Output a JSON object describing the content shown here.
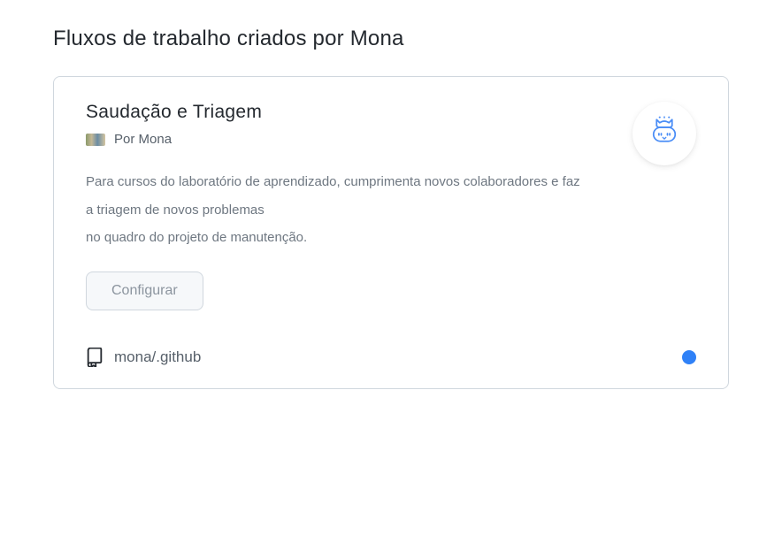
{
  "page": {
    "title": "Fluxos de trabalho criados por Mona"
  },
  "card": {
    "title": "Saudação e Triagem",
    "byline_prefix": "Por ",
    "author": "Mona",
    "description_line1": "Para cursos do laboratório de aprendizado, cumprimenta novos colaboradores e faz a triagem de novos problemas",
    "description_line2": "no quadro do projeto de manutenção.",
    "configure_label": "Configurar",
    "repo_path": "mona/.github",
    "status_color": "#2f81f7"
  },
  "icons": {
    "repo": "repo-icon",
    "mona": "mona-icon"
  }
}
